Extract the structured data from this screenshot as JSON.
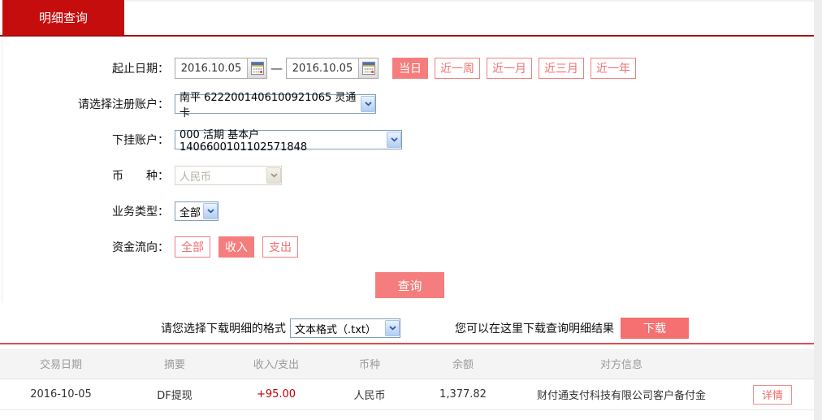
{
  "tab": {
    "title": "明细查询"
  },
  "form": {
    "date_range": {
      "label": "起止日期：",
      "start": "2016.10.05",
      "separator": "—",
      "end": "2016.10.05"
    },
    "quick_ranges": [
      {
        "label": "当日",
        "active": true
      },
      {
        "label": "近一周",
        "active": false
      },
      {
        "label": "近一月",
        "active": false
      },
      {
        "label": "近三月",
        "active": false
      },
      {
        "label": "近一年",
        "active": false
      }
    ],
    "registered_account": {
      "label": "请选择注册账户：",
      "value": "南平 6222001406100921065 灵通卡"
    },
    "sub_account": {
      "label": "下挂账户：",
      "value": "000 活期 基本户 1406600101102571848"
    },
    "currency": {
      "label": "币　　种：",
      "value": "人民币",
      "disabled": true
    },
    "business_type": {
      "label": "业务类型：",
      "value": "全部"
    },
    "fund_flow": {
      "label": "资金流向：",
      "options": [
        {
          "label": "全部",
          "active": false
        },
        {
          "label": "收入",
          "active": true
        },
        {
          "label": "支出",
          "active": false
        }
      ]
    },
    "query_button": "查询"
  },
  "download": {
    "format_label": "请您选择下载明细的格式",
    "format_value": "文本格式（.txt）",
    "hint": "您可以在这里下载查询明细结果",
    "button": "下载"
  },
  "table": {
    "headers": [
      "交易日期",
      "摘要",
      "收入/支出",
      "币种",
      "余额",
      "对方信息"
    ],
    "rows": [
      {
        "date": "2016-10-05",
        "summary": "DF提现",
        "amount": "+95.00",
        "currency": "人民币",
        "balance": "1,377.82",
        "counterparty": "财付通支付科技有限公司客户备付金",
        "detail_button": "详情"
      }
    ]
  },
  "colors": {
    "tab_red": "#c50d0d",
    "underline_red": "#a50d0d",
    "salmon": "#f57d7d",
    "salmon_border": "#f08080",
    "divider_red": "#e14d4d",
    "amount_red": "#c00000",
    "header_bg": "#f4f4f4",
    "header_text": "#9b9b9b"
  }
}
